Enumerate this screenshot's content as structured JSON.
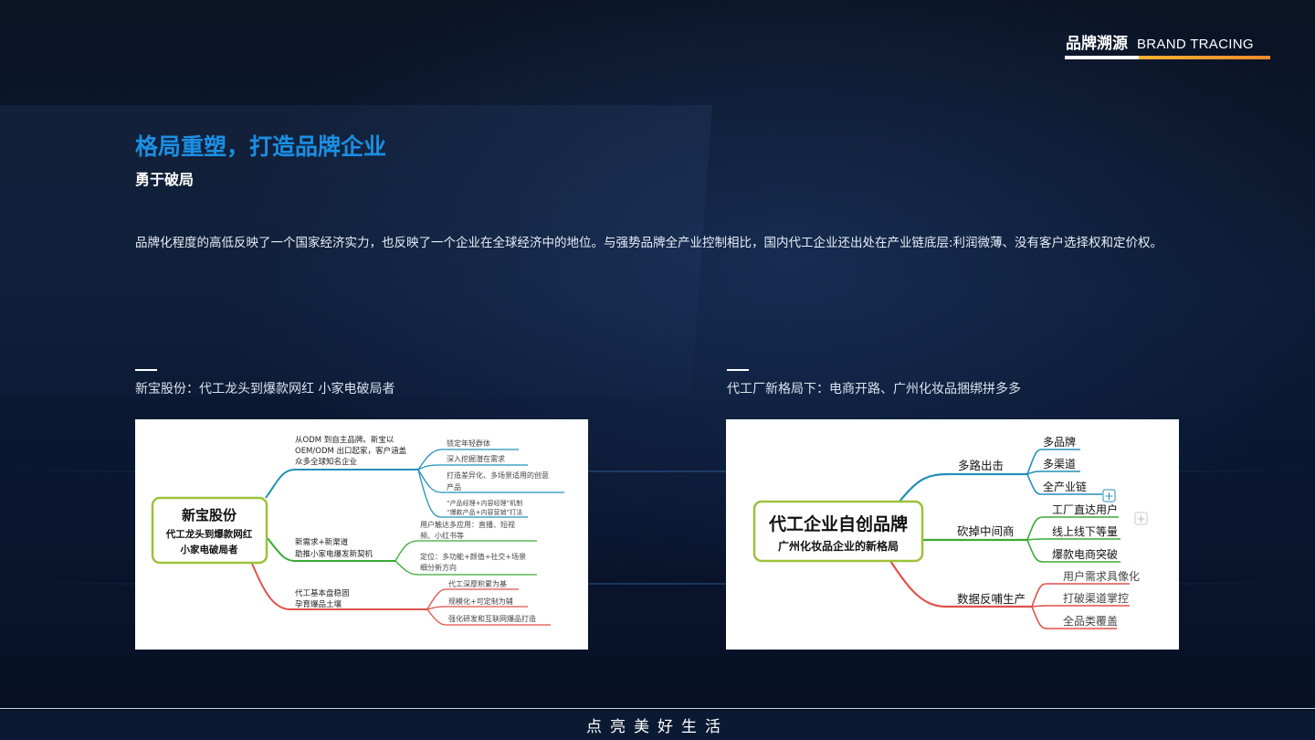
{
  "header": {
    "brand_cn": "品牌溯源",
    "brand_en": "BRAND TRACING"
  },
  "main": {
    "title": "格局重塑，打造品牌企业",
    "subtitle": "勇于破局",
    "paragraph": "品牌化程度的高低反映了一个国家经济实力，也反映了一个企业在全球经济中的地位。与强势品牌全产业控制相比，国内代工企业还出处在产业链底层:利润微薄、没有客户选择权和定价权。"
  },
  "left_figure": {
    "caption": "新宝股份：代工龙头到爆款网红 小家电破局者",
    "root_title": "新宝股份",
    "root_line1": "代工龙头到爆款网红",
    "root_line2": "小家电破局者",
    "b1_l1": "从ODM 到自主品牌。新宝以",
    "b1_l2": "OEM/ODM 出口起家，客户涵盖",
    "b1_l3": "众多全球知名企业",
    "b1_c1": "锁定年轻群体",
    "b1_c2": "深入挖掘潜在需求",
    "b1_c3a": "打造差异化、多场景适用的创意",
    "b1_c3b": "产品",
    "b1_c4a": "“产品经理+内容经理”机制",
    "b1_c4b": "“爆款产品+内容营销”打法",
    "b2_l1": "新需求+新渠道",
    "b2_l2": "助推小家电爆发新契机",
    "b2_c1a": "用户触达多应用：直播、短视",
    "b2_c1b": "频、小红书等",
    "b2_c2a": "定位：多功能+颜值+社交+场景",
    "b2_c2b": "细分新方向",
    "b3_l1": "代工基本盘稳固",
    "b3_l2": "孕育爆品土壤",
    "b3_c1": "代工深厚积累为基",
    "b3_c2": "规模化+可定制为辅",
    "b3_c3": "强化研发和互联网爆品打造"
  },
  "right_figure": {
    "caption": "代工厂新格局下：电商开路、广州化妆品捆绑拼多多",
    "root_title": "代工企业自创品牌",
    "root_sub": "广州化妆品企业的新格局",
    "b1": "多路出击",
    "b1_c1": "多品牌",
    "b1_c2": "多渠道",
    "b1_c3": "全产业链",
    "b2": "砍掉中间商",
    "b2_c1": "工厂直达用户",
    "b2_c2": "线上线下等量",
    "b2_c3": "爆款电商突破",
    "b3": "数据反哺生产",
    "b3_c1": "用户需求具像化",
    "b3_c2": "打破渠道掌控",
    "b3_c3": "全品类覆盖"
  },
  "footer": {
    "slogan": "点亮美好生活"
  },
  "colors": {
    "accent": "#1a8fe3",
    "mm_blue": "#2390b8",
    "mm_green": "#3aaa35",
    "mm_red": "#e0524a",
    "mm_root": "#9cc23a"
  }
}
